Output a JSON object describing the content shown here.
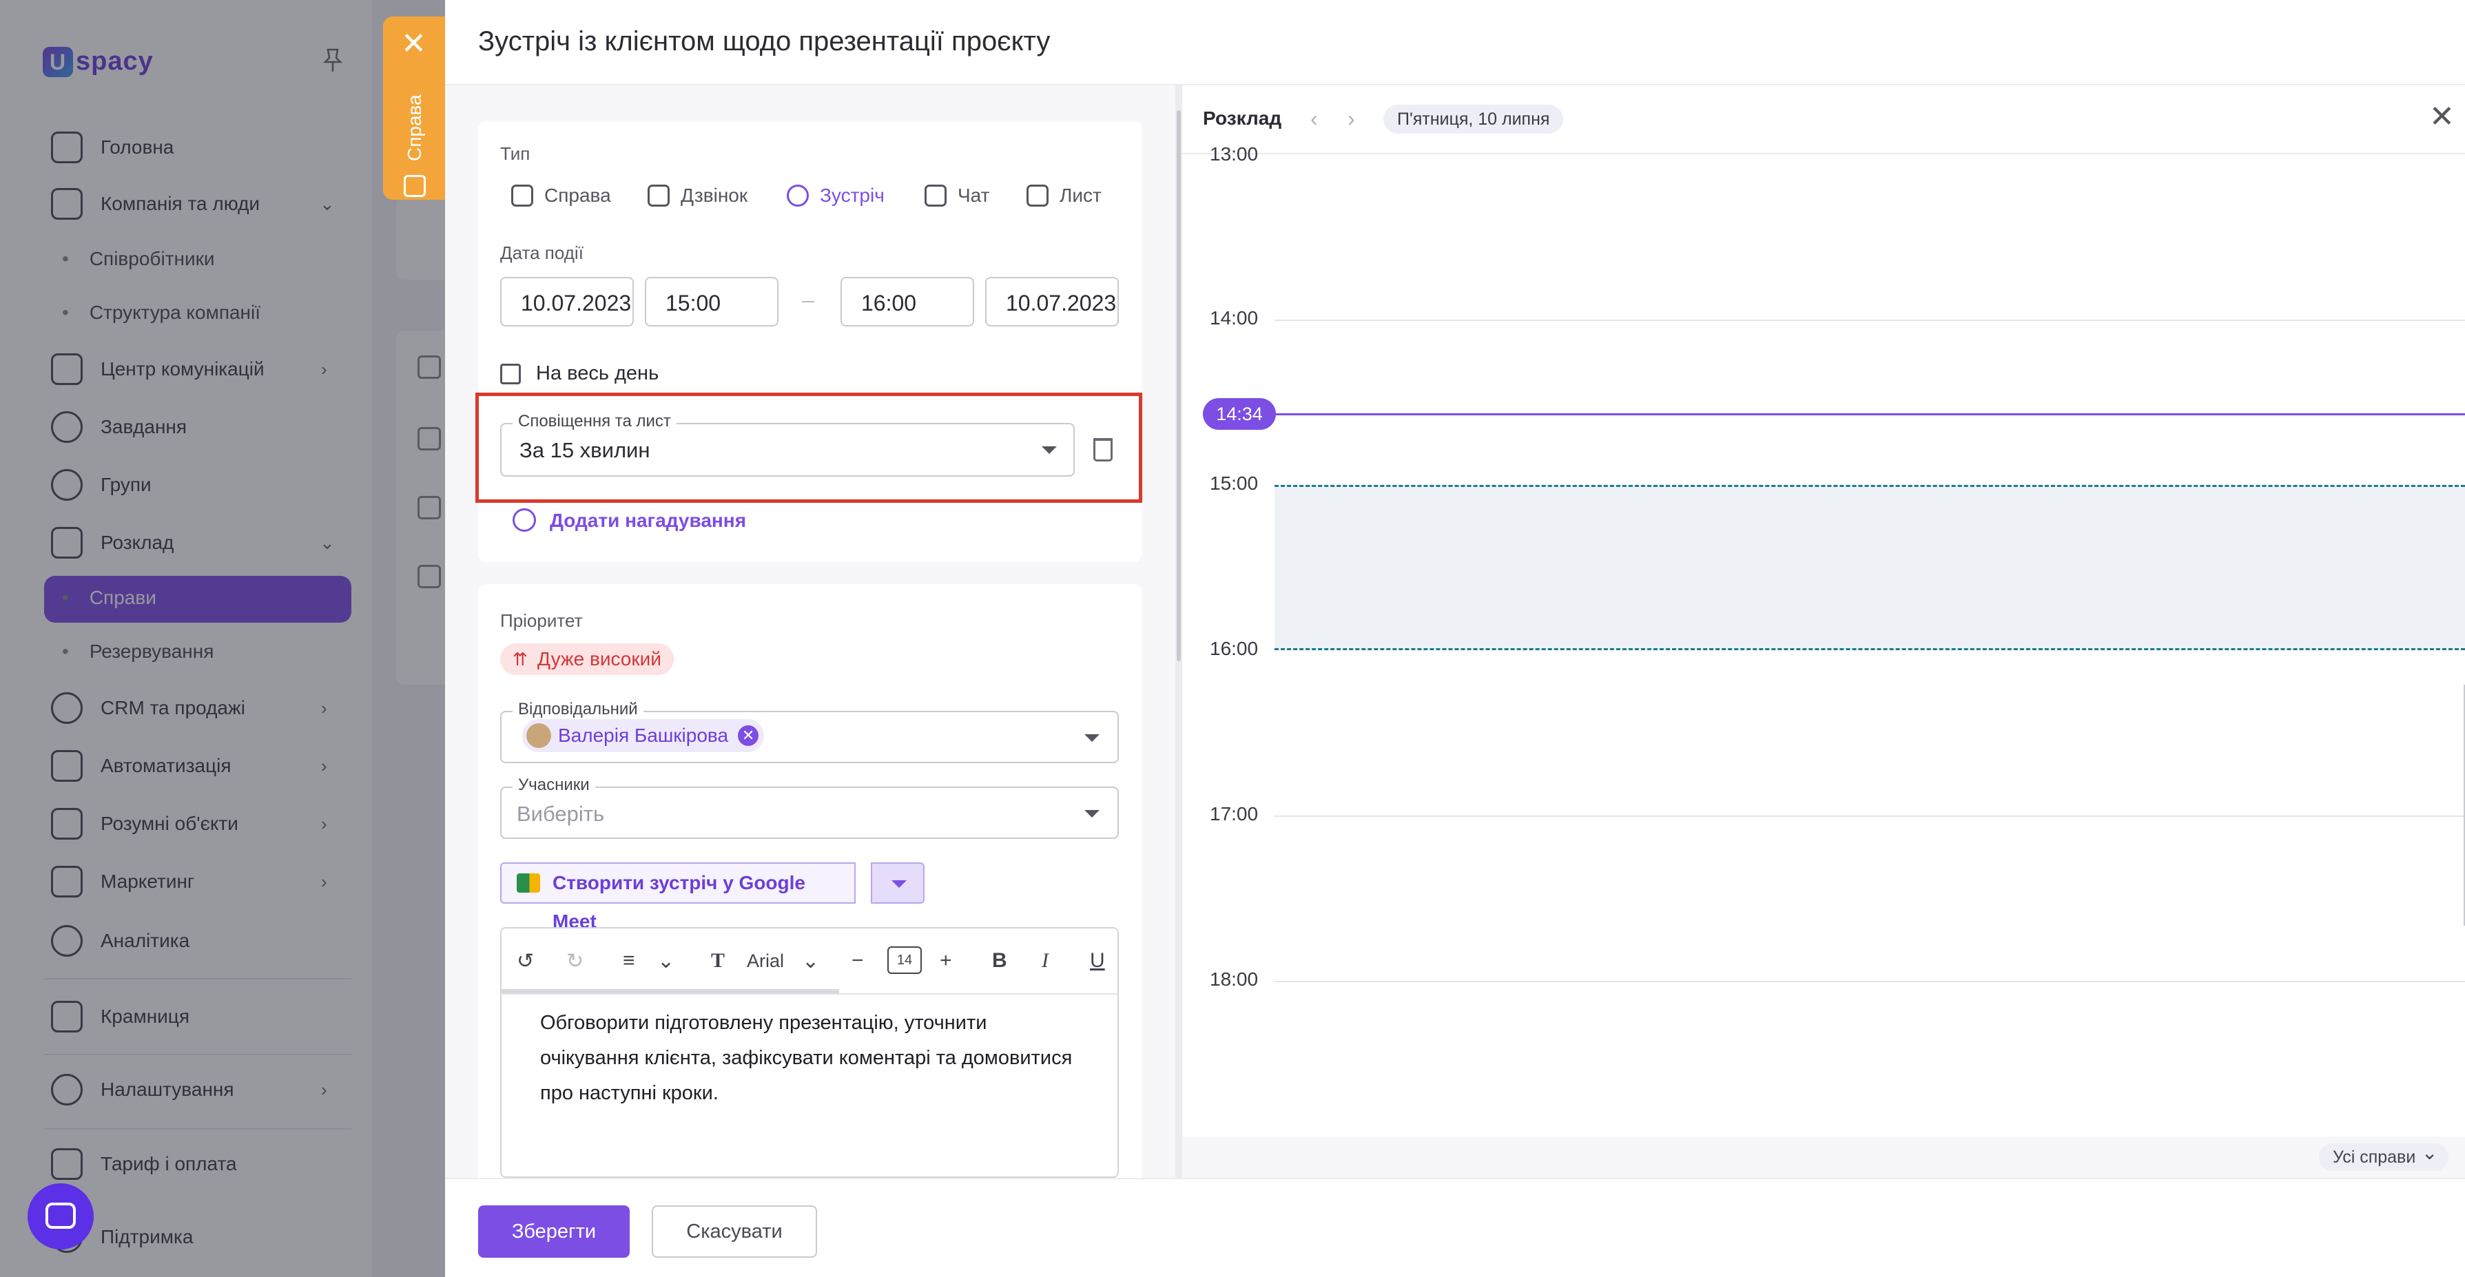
{
  "sidebar": {
    "logo": "spacy",
    "items": [
      {
        "label": "Головна"
      },
      {
        "label": "Компанія та люди"
      },
      {
        "label": "Співробітники"
      },
      {
        "label": "Структура компанії"
      },
      {
        "label": "Центр комунікацій"
      },
      {
        "label": "Завдання"
      },
      {
        "label": "Групи"
      },
      {
        "label": "Розклад"
      },
      {
        "label": "Справи"
      },
      {
        "label": "Резервування"
      },
      {
        "label": "CRM та продажі"
      },
      {
        "label": "Автоматизація"
      },
      {
        "label": "Розумні об'єкти"
      },
      {
        "label": "Маркетинг"
      },
      {
        "label": "Аналітика"
      },
      {
        "label": "Крамниця"
      },
      {
        "label": "Налаштування"
      },
      {
        "label": "Тариф і оплата"
      },
      {
        "label": "Підтримка"
      }
    ]
  },
  "side_tab": {
    "label": "Справа",
    "close": "✕"
  },
  "modal": {
    "title": "Зустріч із клієнтом щодо презентації проєкту",
    "type_label": "Тип",
    "types": [
      {
        "label": "Справа"
      },
      {
        "label": "Дзвінок"
      },
      {
        "label": "Зустріч"
      },
      {
        "label": "Чат"
      },
      {
        "label": "Лист"
      }
    ],
    "event_date_label": "Дата події",
    "start_date": "10.07.2023",
    "start_time": "15:00",
    "end_time": "16:00",
    "end_date": "10.07.2023",
    "all_day_label": "На весь день",
    "notification_legend": "Сповіщення та лист",
    "notification_value": "За 15 хвилин",
    "add_reminder": "Додати нагадування",
    "priority_label": "Пріоритет",
    "priority_value": "Дуже високий",
    "responsible_legend": "Відповідальний",
    "responsible_value": "Валерія Башкірова",
    "participants_legend": "Учасники",
    "participants_placeholder": "Виберіть",
    "meet_button": "Створити зустріч у Google Meet",
    "editor": {
      "font": "Arial",
      "font_size": "14",
      "text": "Обговорити підготовлену презентацію, уточнити очікування клієнта, зафіксувати коментарі та домовитися про наступні кроки."
    },
    "save": "Зберегти",
    "cancel": "Скасувати"
  },
  "schedule": {
    "title": "Розклад",
    "date": "П'ятниця, 10 липня",
    "hours": [
      "13:00",
      "14:00",
      "15:00",
      "16:00",
      "17:00",
      "18:00"
    ],
    "now": "14:34",
    "all_cases": "Усі справи"
  },
  "colors": {
    "accent": "#7c4ee4",
    "highlight": "#d93a2b",
    "side_tab": "#f4a53a",
    "event_border": "#1f7a8c"
  }
}
